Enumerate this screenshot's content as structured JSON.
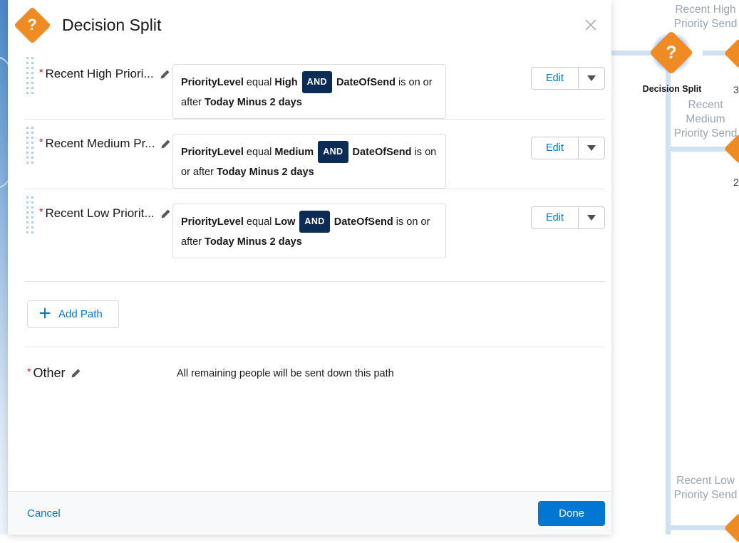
{
  "modal": {
    "title": "Decision Split",
    "icon": "decision-split-diamond-question",
    "close_label": "×"
  },
  "paths": [
    {
      "name": "Recent High Priori...",
      "required": "*",
      "criteria": {
        "field1": "PriorityLevel",
        "operator1": "equal",
        "value1": "High",
        "connector": "AND",
        "field2": "DateOfSend",
        "operator2": "is on or after",
        "value2": "Today Minus 2 days"
      },
      "edit_label": "Edit"
    },
    {
      "name": "Recent Medium Pr...",
      "required": "*",
      "criteria": {
        "field1": "PriorityLevel",
        "operator1": "equal",
        "value1": "Medium",
        "connector": "AND",
        "field2": "DateOfSend",
        "operator2": "is on or after",
        "value2": "Today Minus 2 days"
      },
      "edit_label": "Edit"
    },
    {
      "name": "Recent Low Priorit...",
      "required": "*",
      "criteria": {
        "field1": "PriorityLevel",
        "operator1": "equal",
        "value1": "Low",
        "connector": "AND",
        "field2": "DateOfSend",
        "operator2": "is on or after",
        "value2": "Today Minus 2 days"
      },
      "edit_label": "Edit"
    }
  ],
  "add_path": {
    "label": "Add Path",
    "icon": "plus-icon"
  },
  "other": {
    "required": "*",
    "label": "Other",
    "description": "All remaining people will be sent down this path"
  },
  "footer": {
    "cancel_label": "Cancel",
    "done_label": "Done"
  },
  "flow": {
    "node_label": "Decision Split",
    "node_icon": "question-mark",
    "branches": [
      {
        "label": "Recent High Priority Send",
        "count": "3"
      },
      {
        "label": "Recent Medium Priority Send",
        "count": "2"
      },
      {
        "label": "Recent Low Priority Send",
        "count": ""
      }
    ]
  },
  "colors": {
    "brand_blue": "#0176d3",
    "decision_orange": "#ef8b23",
    "and_chip": "#0b2c56",
    "required_red": "#ea001e",
    "flow_line": "#cfe2f3"
  }
}
